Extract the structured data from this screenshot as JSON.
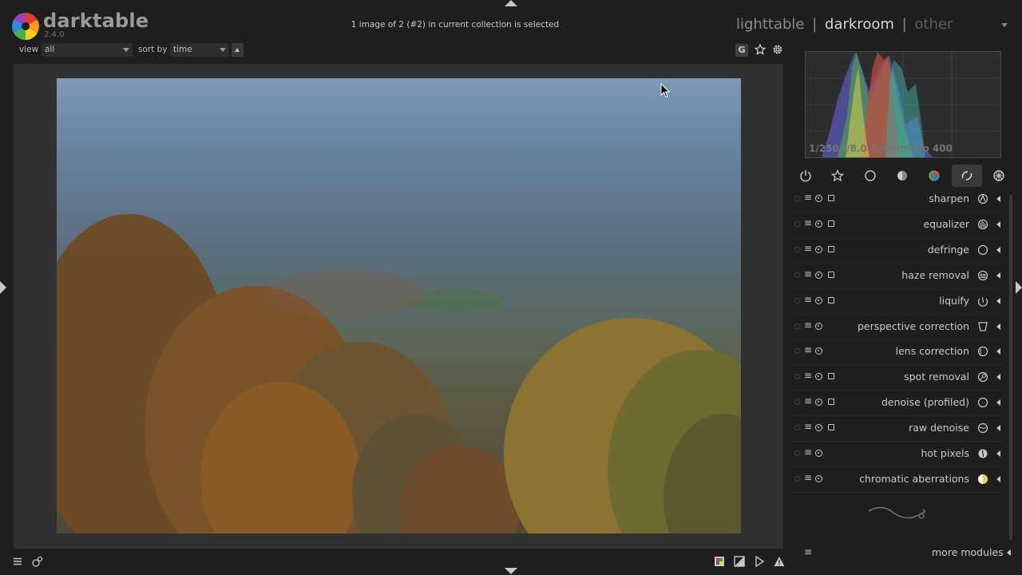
{
  "app": {
    "name": "darktable",
    "version": "2.4.0"
  },
  "status": {
    "message": "1 image of 2 (#2) in current collection is selected"
  },
  "views": {
    "lighttable": "lighttable",
    "darkroom": "darkroom",
    "other": "other",
    "sep": "|",
    "active": "darkroom"
  },
  "filter": {
    "view_label": "view",
    "view_value": "all",
    "sort_label": "sort by",
    "sort_value": "time"
  },
  "toolbar": {
    "grouping_label": "G"
  },
  "histogram": {
    "exif": "1/250 f/8.0 120mm iso 400"
  },
  "module_groups": [
    "active-modules-icon",
    "favourites-icon",
    "basic-group-icon",
    "tone-group-icon",
    "color-group-icon",
    "correction-group-icon",
    "effects-group-icon"
  ],
  "modules": [
    {
      "name": "sharpen",
      "mask": true,
      "icon": "sharpen-icon"
    },
    {
      "name": "equalizer",
      "mask": true,
      "icon": "equalizer-icon"
    },
    {
      "name": "defringe",
      "mask": true,
      "icon": "defringe-icon"
    },
    {
      "name": "haze removal",
      "mask": true,
      "icon": "haze-removal-icon"
    },
    {
      "name": "liquify",
      "mask": true,
      "icon": "liquify-icon"
    },
    {
      "name": "perspective correction",
      "mask": false,
      "icon": "perspective-correction-icon"
    },
    {
      "name": "lens correction",
      "mask": false,
      "icon": "lens-correction-icon"
    },
    {
      "name": "spot removal",
      "mask": true,
      "icon": "spot-removal-icon"
    },
    {
      "name": "denoise (profiled)",
      "mask": true,
      "icon": "denoise-icon"
    },
    {
      "name": "raw denoise",
      "mask": true,
      "icon": "raw-denoise-icon"
    },
    {
      "name": "hot pixels",
      "mask": false,
      "icon": "hot-pixels-icon"
    },
    {
      "name": "chromatic aberrations",
      "mask": false,
      "icon": "chromatic-aberrations-icon"
    }
  ],
  "more_modules": {
    "label": "more modules"
  },
  "colors": {
    "bg": "#1e1e1e",
    "panel": "#313131",
    "text": "#c8c8c8",
    "accent_group": "#3a3a3a"
  }
}
